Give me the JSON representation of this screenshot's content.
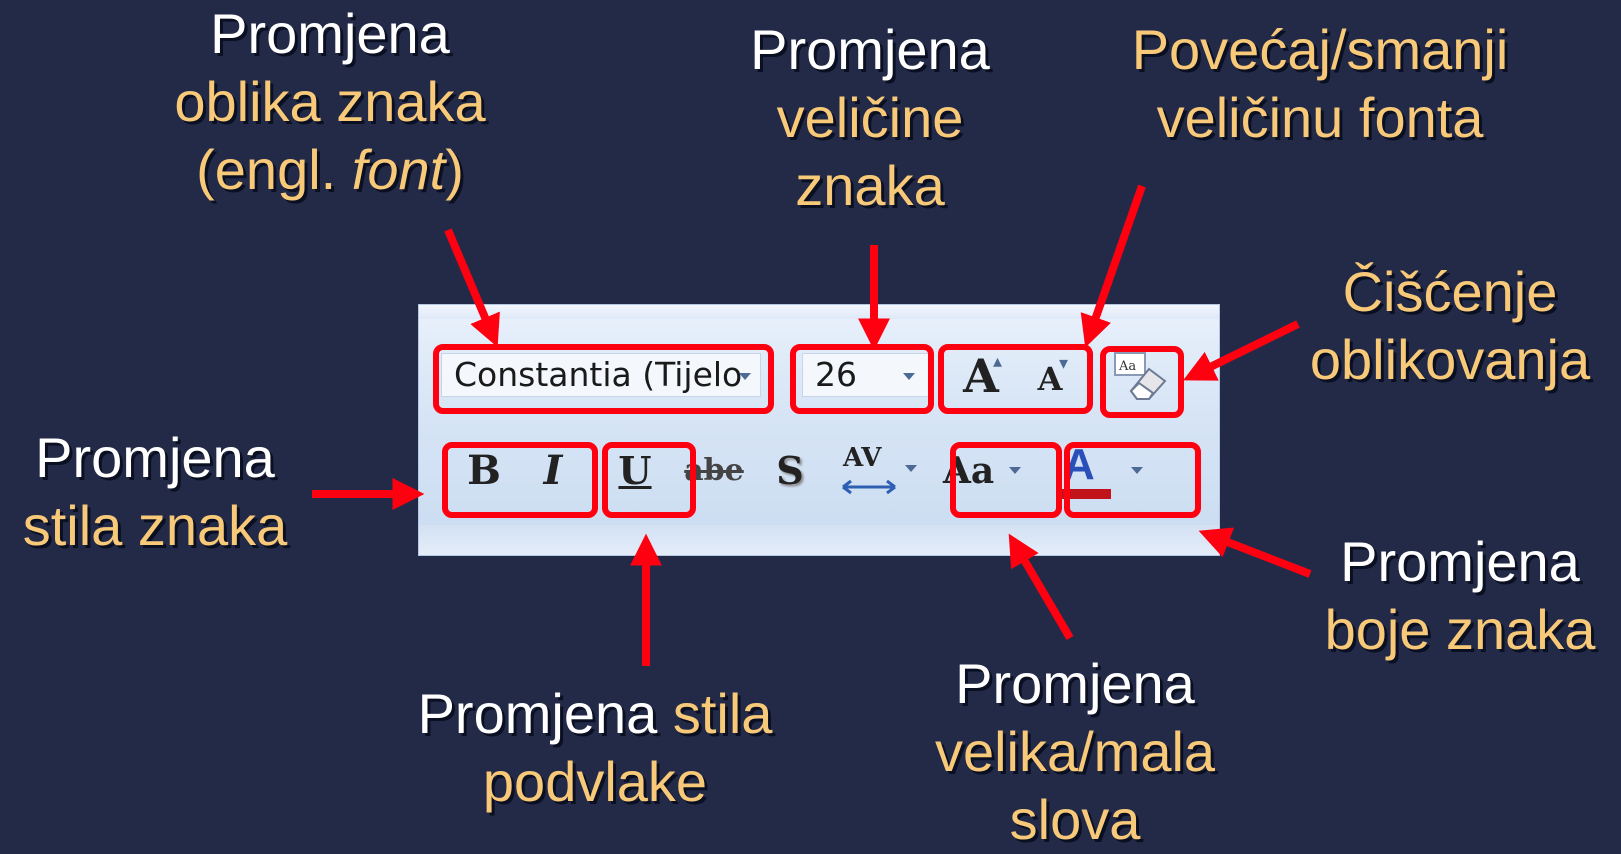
{
  "captions": {
    "font": {
      "l1": "Promjena",
      "l2": "oblika znaka",
      "l3_pre": "(engl. ",
      "l3_it": "font",
      "l3_post": ")"
    },
    "size": {
      "l1": "Promjena",
      "l2": "veličine",
      "l3": "znaka"
    },
    "grow_shrink": {
      "l1": "Povećaj/smanji",
      "l2": "veličinu fonta"
    },
    "clear": {
      "l1": "Čišćenje",
      "l2": "oblikovanja"
    },
    "style": {
      "l1": "Promjena",
      "l2": "stila znaka"
    },
    "underline": {
      "l1_a": "Promjena ",
      "l1_b": "stila",
      "l2": "podvlake"
    },
    "case": {
      "l1": "Promjena",
      "l2": "velika/mala",
      "l3": "slova"
    },
    "color": {
      "l1": "Promjena",
      "l2": "boje znaka"
    }
  },
  "toolbar": {
    "font_name": "Constantia (Tijelo",
    "font_size": "26",
    "grow_label": "A",
    "shrink_label": "A",
    "clear_label": "Aa",
    "bold_label": "B",
    "italic_label": "I",
    "underline_label": "U",
    "strike_label": "abe",
    "shadow_label": "S",
    "spacing_label": "AV",
    "case_label": "Aa",
    "color_label": "A"
  },
  "colors": {
    "background": "#232a48",
    "highlight": "#ff0010",
    "caption_white": "#ffffff",
    "caption_yellow": "#f7c978",
    "font_color_bar": "#c0141a"
  },
  "icons": [
    "dropdown-arrow-icon",
    "grow-font-icon",
    "shrink-font-icon",
    "eraser-icon",
    "character-spacing-icon"
  ]
}
